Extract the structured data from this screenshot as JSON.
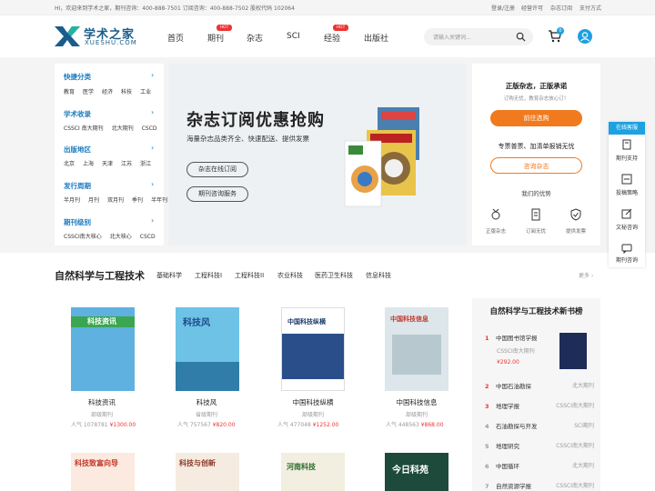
{
  "topbar": {
    "welcome": "HI，欢迎来到学术之家，期刊咨询：400-888-7501  订阅咨询：400-888-7502  股权代码  102064",
    "links": [
      "登录/注册",
      "经营许可",
      "杂志订阅",
      "支付方式"
    ]
  },
  "logo": {
    "cn": "学术之家",
    "en": "XUESHU.COM"
  },
  "nav": [
    {
      "label": "首页",
      "hot": ""
    },
    {
      "label": "期刊",
      "hot": "HOT"
    },
    {
      "label": "杂志",
      "hot": ""
    },
    {
      "label": "SCI",
      "hot": ""
    },
    {
      "label": "经验",
      "hot": "HOT"
    },
    {
      "label": "出版社",
      "hot": ""
    }
  ],
  "search": {
    "placeholder": "请输入关键词..."
  },
  "cart": {
    "count": "0"
  },
  "categories": [
    {
      "title": "快捷分类",
      "items": [
        "教育",
        "医学",
        "经济",
        "科技",
        "工业"
      ]
    },
    {
      "title": "学术收录",
      "items": [
        "CSSCI 南大期刊",
        "北大期刊",
        "CSCD"
      ]
    },
    {
      "title": "出版地区",
      "items": [
        "北京",
        "上海",
        "天津",
        "江苏",
        "浙江"
      ]
    },
    {
      "title": "发行周期",
      "items": [
        "半月刊",
        "月刊",
        "双月刊",
        "季刊",
        "半年刊"
      ]
    },
    {
      "title": "期刊级别",
      "items": [
        "CSSCI南大核心",
        "北大核心",
        "CSCD"
      ]
    }
  ],
  "banner": {
    "title": "杂志订阅优惠抢购",
    "subtitle": "海量杂志品类齐全、快速配送、提供发票",
    "btn1": "杂志在线订阅",
    "btn2": "期刊咨询服务"
  },
  "right_panel": {
    "title": "正版杂志，正版承诺",
    "sub": "订购无忧，教育杂志放心订！",
    "btn1": "前往选购",
    "mid": "专票普票、加清单报销无忧",
    "btn2": "咨询杂志",
    "adv_title": "我们的优势",
    "advs": [
      "正版杂志",
      "订阅无忧",
      "提供发票"
    ]
  },
  "float": {
    "head": "在线客服",
    "items": [
      "期刊支持",
      "投稿策略",
      "文秘咨询",
      "期刊咨询"
    ]
  },
  "section": {
    "title": "自然科学与工程技术",
    "tabs": [
      "基础科学",
      "工程科技I",
      "工程科技II",
      "农业科技",
      "医药卫生科技",
      "信息科技"
    ],
    "more": "更多 ›"
  },
  "books": [
    {
      "name": "科技资讯",
      "type": "部级期刊",
      "pop": "人气 1078781",
      "price": "¥1300.00",
      "cover": "#5fb1e0",
      "coverText": "科技资讯"
    },
    {
      "name": "科技风",
      "type": "省级期刊",
      "pop": "人气 757567",
      "price": "¥820.00",
      "cover": "#6ec2e6",
      "coverText": "科技风"
    },
    {
      "name": "中国科技纵横",
      "type": "部级期刊",
      "pop": "人气 477048",
      "price": "¥1252.00",
      "cover": "#2a4e8a",
      "coverText": "中国科技纵横"
    },
    {
      "name": "中国科技信息",
      "type": "部级期刊",
      "pop": "人气 448563",
      "price": "¥868.00",
      "cover": "#dde6ea",
      "coverText": "中国科技信息"
    }
  ],
  "books_row2": [
    {
      "coverText": "科技致富向导",
      "cover": "#c0392b"
    },
    {
      "coverText": "科技与创新",
      "cover": "#d4a27a"
    },
    {
      "coverText": "河南科技",
      "cover": "#f2efe0"
    },
    {
      "coverText": "今日科苑",
      "cover": "#1d4a3a"
    }
  ],
  "rank": {
    "title": "自然科学与工程技术新书榜",
    "top": {
      "num": "1",
      "name": "中国图书馆学报",
      "tag": "CSSCI南大期刊",
      "price": "¥292.00"
    },
    "rows": [
      {
        "num": "2",
        "name": "中国石油勘探",
        "tag": "北大期刊"
      },
      {
        "num": "3",
        "name": "地理学报",
        "tag": "CSSCI南大期刊"
      },
      {
        "num": "4",
        "name": "石油勘探与开发",
        "tag": "SCI期刊"
      },
      {
        "num": "5",
        "name": "地理研究",
        "tag": "CSSCI南大期刊"
      },
      {
        "num": "6",
        "name": "中国循环",
        "tag": "北大期刊"
      },
      {
        "num": "7",
        "name": "自然资源学报",
        "tag": "CSSCI南大期刊"
      }
    ]
  }
}
